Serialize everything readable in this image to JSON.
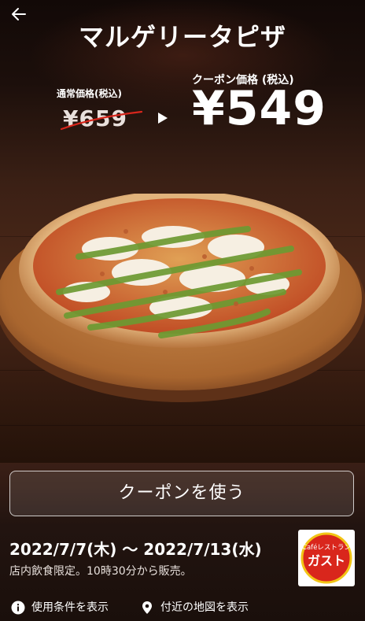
{
  "header": {
    "title": "マルゲリータピザ"
  },
  "pricing": {
    "regular_label": "通常価格(税込)",
    "regular_price": "¥659",
    "coupon_label": "クーポン価格 (税込)",
    "coupon_price": "¥549"
  },
  "actions": {
    "use_coupon": "クーポンを使う"
  },
  "validity": {
    "period": "2022/7/7(木) 〜 2022/7/13(水)",
    "note": "店内飲食限定。10時30分から販売。"
  },
  "brand": {
    "logo_small": "Caféレストラン",
    "logo_main": "ガスト",
    "colors": {
      "red": "#d9261c",
      "yellow": "#f2c515"
    }
  },
  "footer_links": {
    "conditions": "使用条件を表示",
    "map": "付近の地図を表示"
  },
  "colors": {
    "header_bg": "#1c0f0b",
    "wood": "#4b2818",
    "bottom_bg": "#221410"
  }
}
